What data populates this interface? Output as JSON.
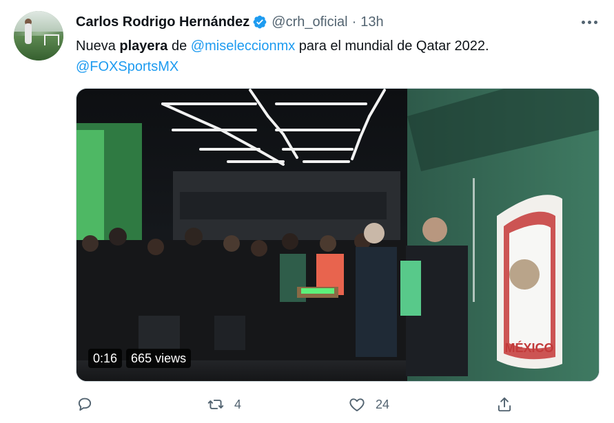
{
  "author": {
    "display_name": "Carlos Rodrigo Hernández",
    "handle": "@crh_oficial",
    "separator": "·",
    "time": "13h",
    "verified": true
  },
  "tweet": {
    "text_part1": "Nueva ",
    "text_bold": "playera",
    "text_part2": " de ",
    "mention_1": "@miseleccionmx",
    "text_part3": " para el mundial de Qatar 2022.",
    "mention_2": "@FOXSportsMX"
  },
  "video": {
    "duration": "0:16",
    "views": "665 views",
    "crest_text": "MÉXICO"
  },
  "actions": {
    "reply_count": "",
    "retweet_count": "4",
    "like_count": "24"
  },
  "icons": [
    "more-icon",
    "verified-icon",
    "reply-icon",
    "retweet-icon",
    "like-icon",
    "share-icon"
  ],
  "colors": {
    "accent": "#1d9bf0",
    "text": "#0f1419",
    "muted": "#536471"
  }
}
